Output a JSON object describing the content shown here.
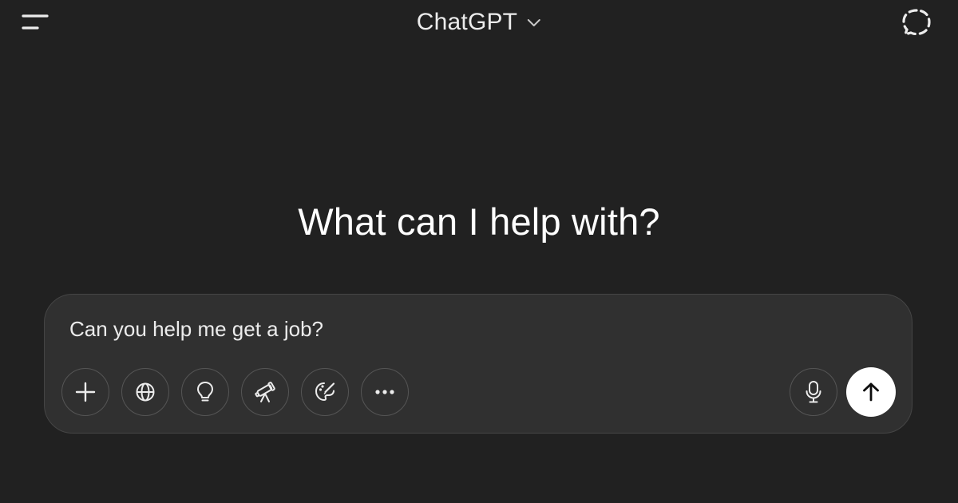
{
  "header": {
    "menu_icon": "sidebar-menu-icon",
    "model_name": "ChatGPT",
    "model_chevron_icon": "chevron-down-icon",
    "temp_chat_icon": "dashed-chat-bubble-icon"
  },
  "main": {
    "headline": "What can I help with?"
  },
  "composer": {
    "input_value": "Can you help me get a job?",
    "tools": [
      {
        "name": "attach",
        "icon": "plus-icon"
      },
      {
        "name": "search",
        "icon": "globe-icon"
      },
      {
        "name": "reason",
        "icon": "lightbulb-icon"
      },
      {
        "name": "deep-research",
        "icon": "telescope-icon"
      },
      {
        "name": "create-image",
        "icon": "palette-icon"
      },
      {
        "name": "more",
        "icon": "more-dots-icon"
      }
    ],
    "voice_icon": "microphone-icon",
    "send_icon": "arrow-up-icon"
  },
  "colors": {
    "background": "#212121",
    "composer_bg": "#303030",
    "composer_border": "#454545",
    "text": "#ececec",
    "send_button": "#ffffff"
  }
}
